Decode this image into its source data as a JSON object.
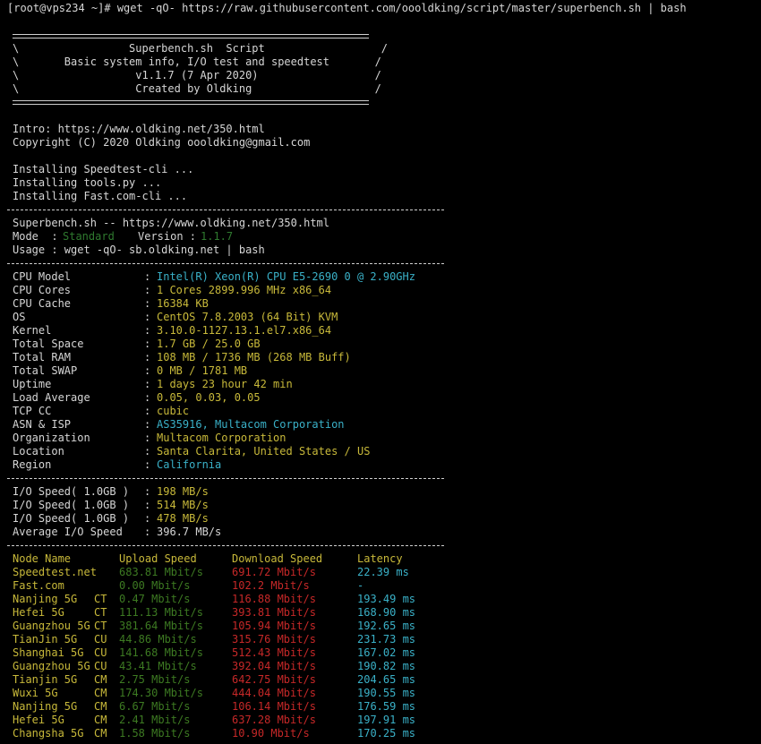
{
  "command": "[root@vps234 ~]# wget -qO- https://raw.githubusercontent.com/oooldking/script/master/superbench.sh | bash",
  "banner": {
    "lines": [
      "\\                 Superbench.sh  Script                  /",
      "\\       Basic system info, I/O test and speedtest       /",
      "\\                  v1.1.7 (7 Apr 2020)                  /",
      "\\                  Created by Oldking                   /"
    ]
  },
  "intro": "Intro: https://www.oldking.net/350.html",
  "copyright": "Copyright (C) 2020 Oldking oooldking@gmail.com",
  "installing": [
    "Installing Speedtest-cli ...",
    "Installing tools.py ...",
    "Installing Fast.com-cli ..."
  ],
  "header": {
    "title": "Superbench.sh -- https://www.oldking.net/350.html",
    "mode_label": "Mode  :",
    "mode_value": "Standard",
    "version_label": "Version :",
    "version_value": "1.1.7",
    "usage": "Usage : wget -qO- sb.oldking.net | bash"
  },
  "sysinfo": [
    {
      "label": "CPU Model",
      "value": "Intel(R) Xeon(R) CPU E5-2690 0 @ 2.90GHz",
      "color": "#3ab1c8"
    },
    {
      "label": "CPU Cores",
      "value": "1 Cores 2899.996 MHz x86_64",
      "color": "#c8b93a"
    },
    {
      "label": "CPU Cache",
      "value": "16384 KB",
      "color": "#c8b93a"
    },
    {
      "label": "OS",
      "value": "CentOS 7.8.2003 (64 Bit) KVM",
      "color": "#c8b93a"
    },
    {
      "label": "Kernel",
      "value": "3.10.0-1127.13.1.el7.x86_64",
      "color": "#c8b93a"
    },
    {
      "label": "Total Space",
      "value": "1.7 GB / 25.0 GB",
      "color": "#c8b93a"
    },
    {
      "label": "Total RAM",
      "value": "108 MB / 1736 MB (268 MB Buff)",
      "color": "#c8b93a"
    },
    {
      "label": "Total SWAP",
      "value": "0 MB / 1781 MB",
      "color": "#c8b93a"
    },
    {
      "label": "Uptime",
      "value": "1 days 23 hour 42 min",
      "color": "#c8b93a"
    },
    {
      "label": "Load Average",
      "value": "0.05, 0.03, 0.05",
      "color": "#c8b93a"
    },
    {
      "label": "TCP CC",
      "value": "cubic",
      "color": "#c8b93a"
    },
    {
      "label": "ASN & ISP",
      "value": "AS35916, Multacom Corporation",
      "color": "#3ab1c8"
    },
    {
      "label": "Organization",
      "value": "Multacom Corporation",
      "color": "#c8b93a"
    },
    {
      "label": "Location",
      "value": "Santa Clarita, United States / US",
      "color": "#c8b93a"
    },
    {
      "label": "Region",
      "value": "California",
      "color": "#3ab1c8"
    }
  ],
  "io": [
    {
      "label": "I/O Speed( 1.0GB )",
      "value": "198 MB/s",
      "color": "#c8b93a"
    },
    {
      "label": "I/O Speed( 1.0GB )",
      "value": "514 MB/s",
      "color": "#c8b93a"
    },
    {
      "label": "I/O Speed( 1.0GB )",
      "value": "478 MB/s",
      "color": "#c8b93a"
    },
    {
      "label": "Average I/O Speed",
      "value": "396.7 MB/s",
      "color": "#d6d6d6"
    }
  ],
  "speed_headers": {
    "node": "Node Name",
    "upload": "Upload Speed",
    "download": "Download Speed",
    "latency": "Latency"
  },
  "speedtests": [
    {
      "node": "Speedtest.net",
      "isp": "",
      "upload": "683.81 Mbit/s",
      "download": "691.72 Mbit/s",
      "latency": "22.39 ms"
    },
    {
      "node": "Fast.com",
      "isp": "",
      "upload": "0.00 Mbit/s",
      "download": "102.2 Mbit/s",
      "latency": "-"
    },
    {
      "node": "Nanjing 5G",
      "isp": "CT",
      "upload": "0.47 Mbit/s",
      "download": "116.88 Mbit/s",
      "latency": "193.49 ms"
    },
    {
      "node": "Hefei 5G",
      "isp": "CT",
      "upload": "111.13 Mbit/s",
      "download": "393.81 Mbit/s",
      "latency": "168.90 ms"
    },
    {
      "node": "Guangzhou 5G",
      "isp": "CT",
      "upload": "381.64 Mbit/s",
      "download": "105.94 Mbit/s",
      "latency": "192.65 ms"
    },
    {
      "node": "TianJin 5G",
      "isp": "CU",
      "upload": "44.86 Mbit/s",
      "download": "315.76 Mbit/s",
      "latency": "231.73 ms"
    },
    {
      "node": "Shanghai 5G",
      "isp": "CU",
      "upload": "141.68 Mbit/s",
      "download": "512.43 Mbit/s",
      "latency": "167.02 ms"
    },
    {
      "node": "Guangzhou 5G",
      "isp": "CU",
      "upload": "43.41 Mbit/s",
      "download": "392.04 Mbit/s",
      "latency": "190.82 ms"
    },
    {
      "node": "Tianjin 5G",
      "isp": "CM",
      "upload": "2.75 Mbit/s",
      "download": "642.75 Mbit/s",
      "latency": "204.65 ms"
    },
    {
      "node": "Wuxi 5G",
      "isp": "CM",
      "upload": "174.30 Mbit/s",
      "download": "444.04 Mbit/s",
      "latency": "190.55 ms"
    },
    {
      "node": "Nanjing 5G",
      "isp": "CM",
      "upload": "6.67 Mbit/s",
      "download": "106.14 Mbit/s",
      "latency": "176.59 ms"
    },
    {
      "node": "Hefei 5G",
      "isp": "CM",
      "upload": "2.41 Mbit/s",
      "download": "637.28 Mbit/s",
      "latency": "197.91 ms"
    },
    {
      "node": "Changsha 5G",
      "isp": "CM",
      "upload": "1.58 Mbit/s",
      "download": "10.90 Mbit/s",
      "latency": "170.25 ms"
    }
  ],
  "colors": {
    "background": "#000000",
    "text": "#d6d6d6",
    "cyan": "#3ab1c8",
    "yellow": "#c8b93a",
    "green": "#8bb832",
    "dark_green": "#3d7a22",
    "red": "#c62828"
  }
}
